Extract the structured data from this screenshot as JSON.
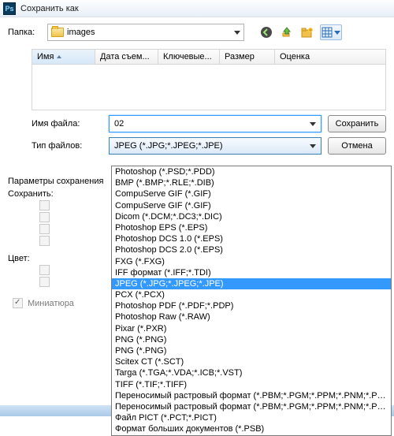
{
  "title": "Сохранить как",
  "folder": {
    "label": "Папка:",
    "value": "images"
  },
  "columns": {
    "name": "Имя",
    "date": "Дата съем...",
    "keys": "Ключевые...",
    "size": "Размер",
    "rating": "Оценка"
  },
  "filename": {
    "label": "Имя файла:",
    "value": "02"
  },
  "filetype": {
    "label": "Тип файлов:",
    "value": "JPEG (*.JPG;*.JPEG;*.JPE)"
  },
  "buttons": {
    "save": "Сохранить",
    "cancel": "Отмена"
  },
  "params": {
    "title": "Параметры сохранения",
    "save_label": "Сохранить:",
    "color_label": "Цвет:",
    "thumbnail": "Миниатюра"
  },
  "filetype_options": [
    "Photoshop (*.PSD;*.PDD)",
    "BMP (*.BMP;*.RLE;*.DIB)",
    "CompuServe GIF (*.GIF)",
    "CompuServe GIF (*.GIF)",
    "Dicom (*.DCM;*.DC3;*.DIC)",
    "Photoshop EPS (*.EPS)",
    "Photoshop DCS 1.0 (*.EPS)",
    "Photoshop DCS 2.0 (*.EPS)",
    "FXG (*.FXG)",
    "IFF формат (*.IFF;*.TDI)",
    "JPEG (*.JPG;*.JPEG;*.JPE)",
    "PCX (*.PCX)",
    "Photoshop PDF (*.PDF;*.PDP)",
    "Photoshop Raw (*.RAW)",
    "Pixar (*.PXR)",
    "PNG (*.PNG)",
    "PNG (*.PNG)",
    "Scitex CT (*.SCT)",
    "Targa (*.TGA;*.VDA;*.ICB;*.VST)",
    "TIFF (*.TIF;*.TIFF)",
    "Переносимый растровый формат (*.PBM;*.PGM;*.PPM;*.PNM;*.PFM;*.PAM)",
    "Переносимый растровый формат (*.PBM;*.PGM;*.PPM;*.PNM;*.PFM;*.PAM)",
    "Файл PICT (*.PCT;*.PICT)",
    "Формат больших документов (*.PSB)"
  ],
  "selected_filetype_index": 10
}
